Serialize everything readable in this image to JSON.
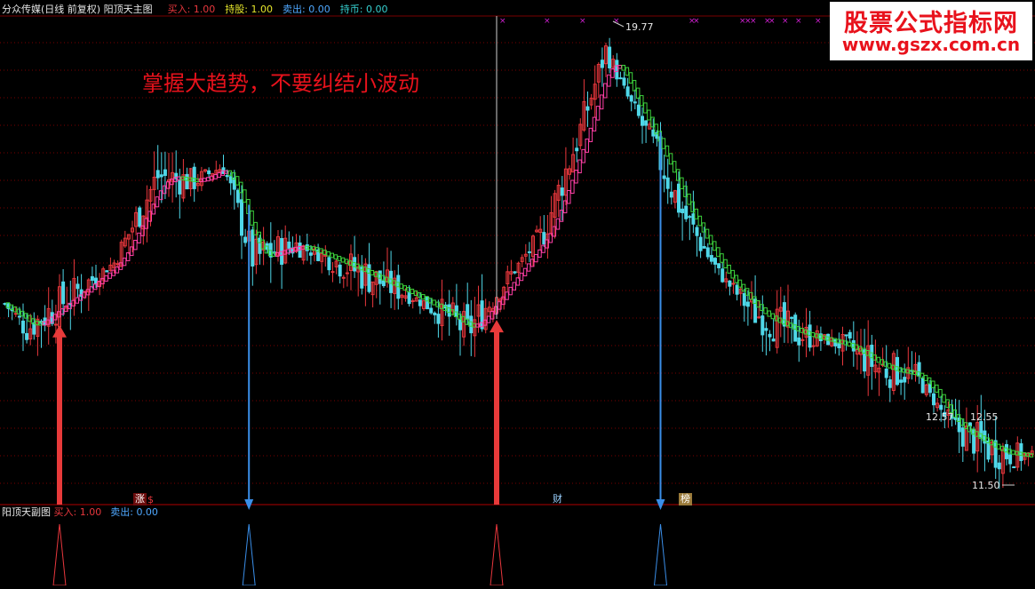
{
  "main_header": {
    "title": "分众传媒(日线 前复权) 阳顶天主图",
    "buy_label": "买入:",
    "buy_value": "1.00",
    "hold_label": "持股:",
    "hold_value": "1.00",
    "sell_label": "卖出:",
    "sell_value": "0.00",
    "cash_label": "持币:",
    "cash_value": "0.00"
  },
  "sub_header": {
    "title": "阳顶天副图",
    "buy_label": "买入:",
    "buy_value": "1.00",
    "sell_label": "卖出:",
    "sell_value": "0.00"
  },
  "annotation": "掌握大趋势，不要纠结小波动",
  "watermark": {
    "title": "股票公式指标网",
    "url": "www.gszx.com.cn"
  },
  "price_labels": {
    "high": "19.77",
    "mid_left": "12.57",
    "mid_right": "12.55",
    "low": "11.50"
  },
  "tags": {
    "zhang": "涨",
    "dollar": "$",
    "cai": "财",
    "bang": "榜"
  },
  "colors": {
    "background": "#000000",
    "up_candle": "#e8373d",
    "down_candle": "#4fd7e8",
    "trend_up": "#ff3fa6",
    "trend_down": "#3cd23c",
    "buy_arrow": "#e83a3a",
    "sell_arrow": "#3a8ee8",
    "grid": "#7a0000",
    "header_white": "#e6e6e6",
    "header_yellow": "#e6e62c",
    "header_blue": "#4fa8ff",
    "header_cyan": "#36d0d0",
    "marker_magenta": "#d020d0"
  },
  "chart_data": {
    "type": "candlestick",
    "price_range": [
      11.0,
      20.3
    ],
    "trend_line_colors": [
      "trend_up",
      "trend_down"
    ],
    "buy_signals": [
      1,
      3
    ],
    "sell_signals": [
      2,
      4
    ],
    "keypoints": [
      [
        0,
        14.8
      ],
      [
        6,
        14.3
      ],
      [
        17,
        14.9
      ],
      [
        30,
        15.6
      ],
      [
        42,
        17.3
      ],
      [
        52,
        17.2
      ],
      [
        60,
        17.5
      ],
      [
        68,
        15.7
      ],
      [
        80,
        15.95
      ],
      [
        95,
        15.5
      ],
      [
        110,
        15.0
      ],
      [
        122,
        14.55
      ],
      [
        127,
        14.25
      ],
      [
        137,
        15.2
      ],
      [
        148,
        16.2
      ],
      [
        158,
        18.2
      ],
      [
        165,
        19.77
      ],
      [
        172,
        18.7
      ],
      [
        178,
        17.9
      ],
      [
        186,
        16.6
      ],
      [
        196,
        15.4
      ],
      [
        206,
        14.6
      ],
      [
        218,
        14.2
      ],
      [
        230,
        14.0
      ],
      [
        240,
        13.55
      ],
      [
        250,
        13.4
      ],
      [
        260,
        12.4
      ],
      [
        272,
        11.9
      ],
      [
        282,
        11.8
      ]
    ],
    "candle_count": 283
  }
}
